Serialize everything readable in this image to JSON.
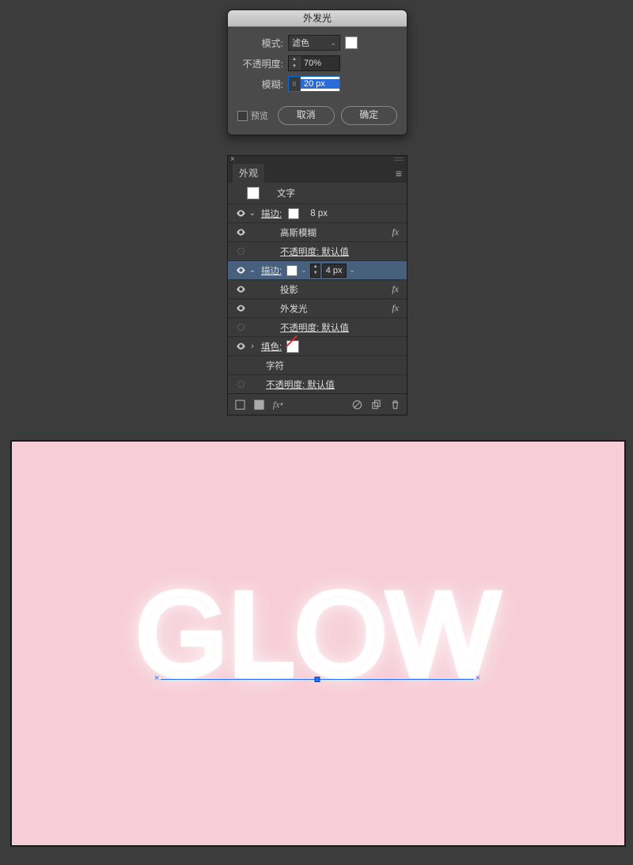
{
  "dialog": {
    "title": "外发光",
    "mode_label": "模式:",
    "mode_value": "滤色",
    "mode_swatch": "#ffffff",
    "opacity_label": "不透明度:",
    "opacity_value": "70%",
    "blur_label": "模糊:",
    "blur_value": "20 px",
    "preview_label": "预览",
    "cancel": "取消",
    "ok": "确定"
  },
  "appearance": {
    "tab": "外观",
    "type_label": "文字",
    "rows": {
      "stroke1": {
        "label": "描边:",
        "weight": "8 px"
      },
      "gauss": {
        "label": "高斯模糊"
      },
      "opacity_default_a": {
        "label": "不透明度: 默认值"
      },
      "stroke2": {
        "label": "描边:",
        "weight": "4 px"
      },
      "shadow": {
        "label": "投影"
      },
      "outer_glow": {
        "label": "外发光"
      },
      "opacity_default_b": {
        "label": "不透明度: 默认值"
      },
      "fill": {
        "label": "填色:"
      },
      "char": {
        "label": "字符"
      },
      "opacity_default_c": {
        "label": "不透明度: 默认值"
      }
    }
  },
  "canvas": {
    "text": "GLOW",
    "bg_color": "#f7ced7"
  }
}
